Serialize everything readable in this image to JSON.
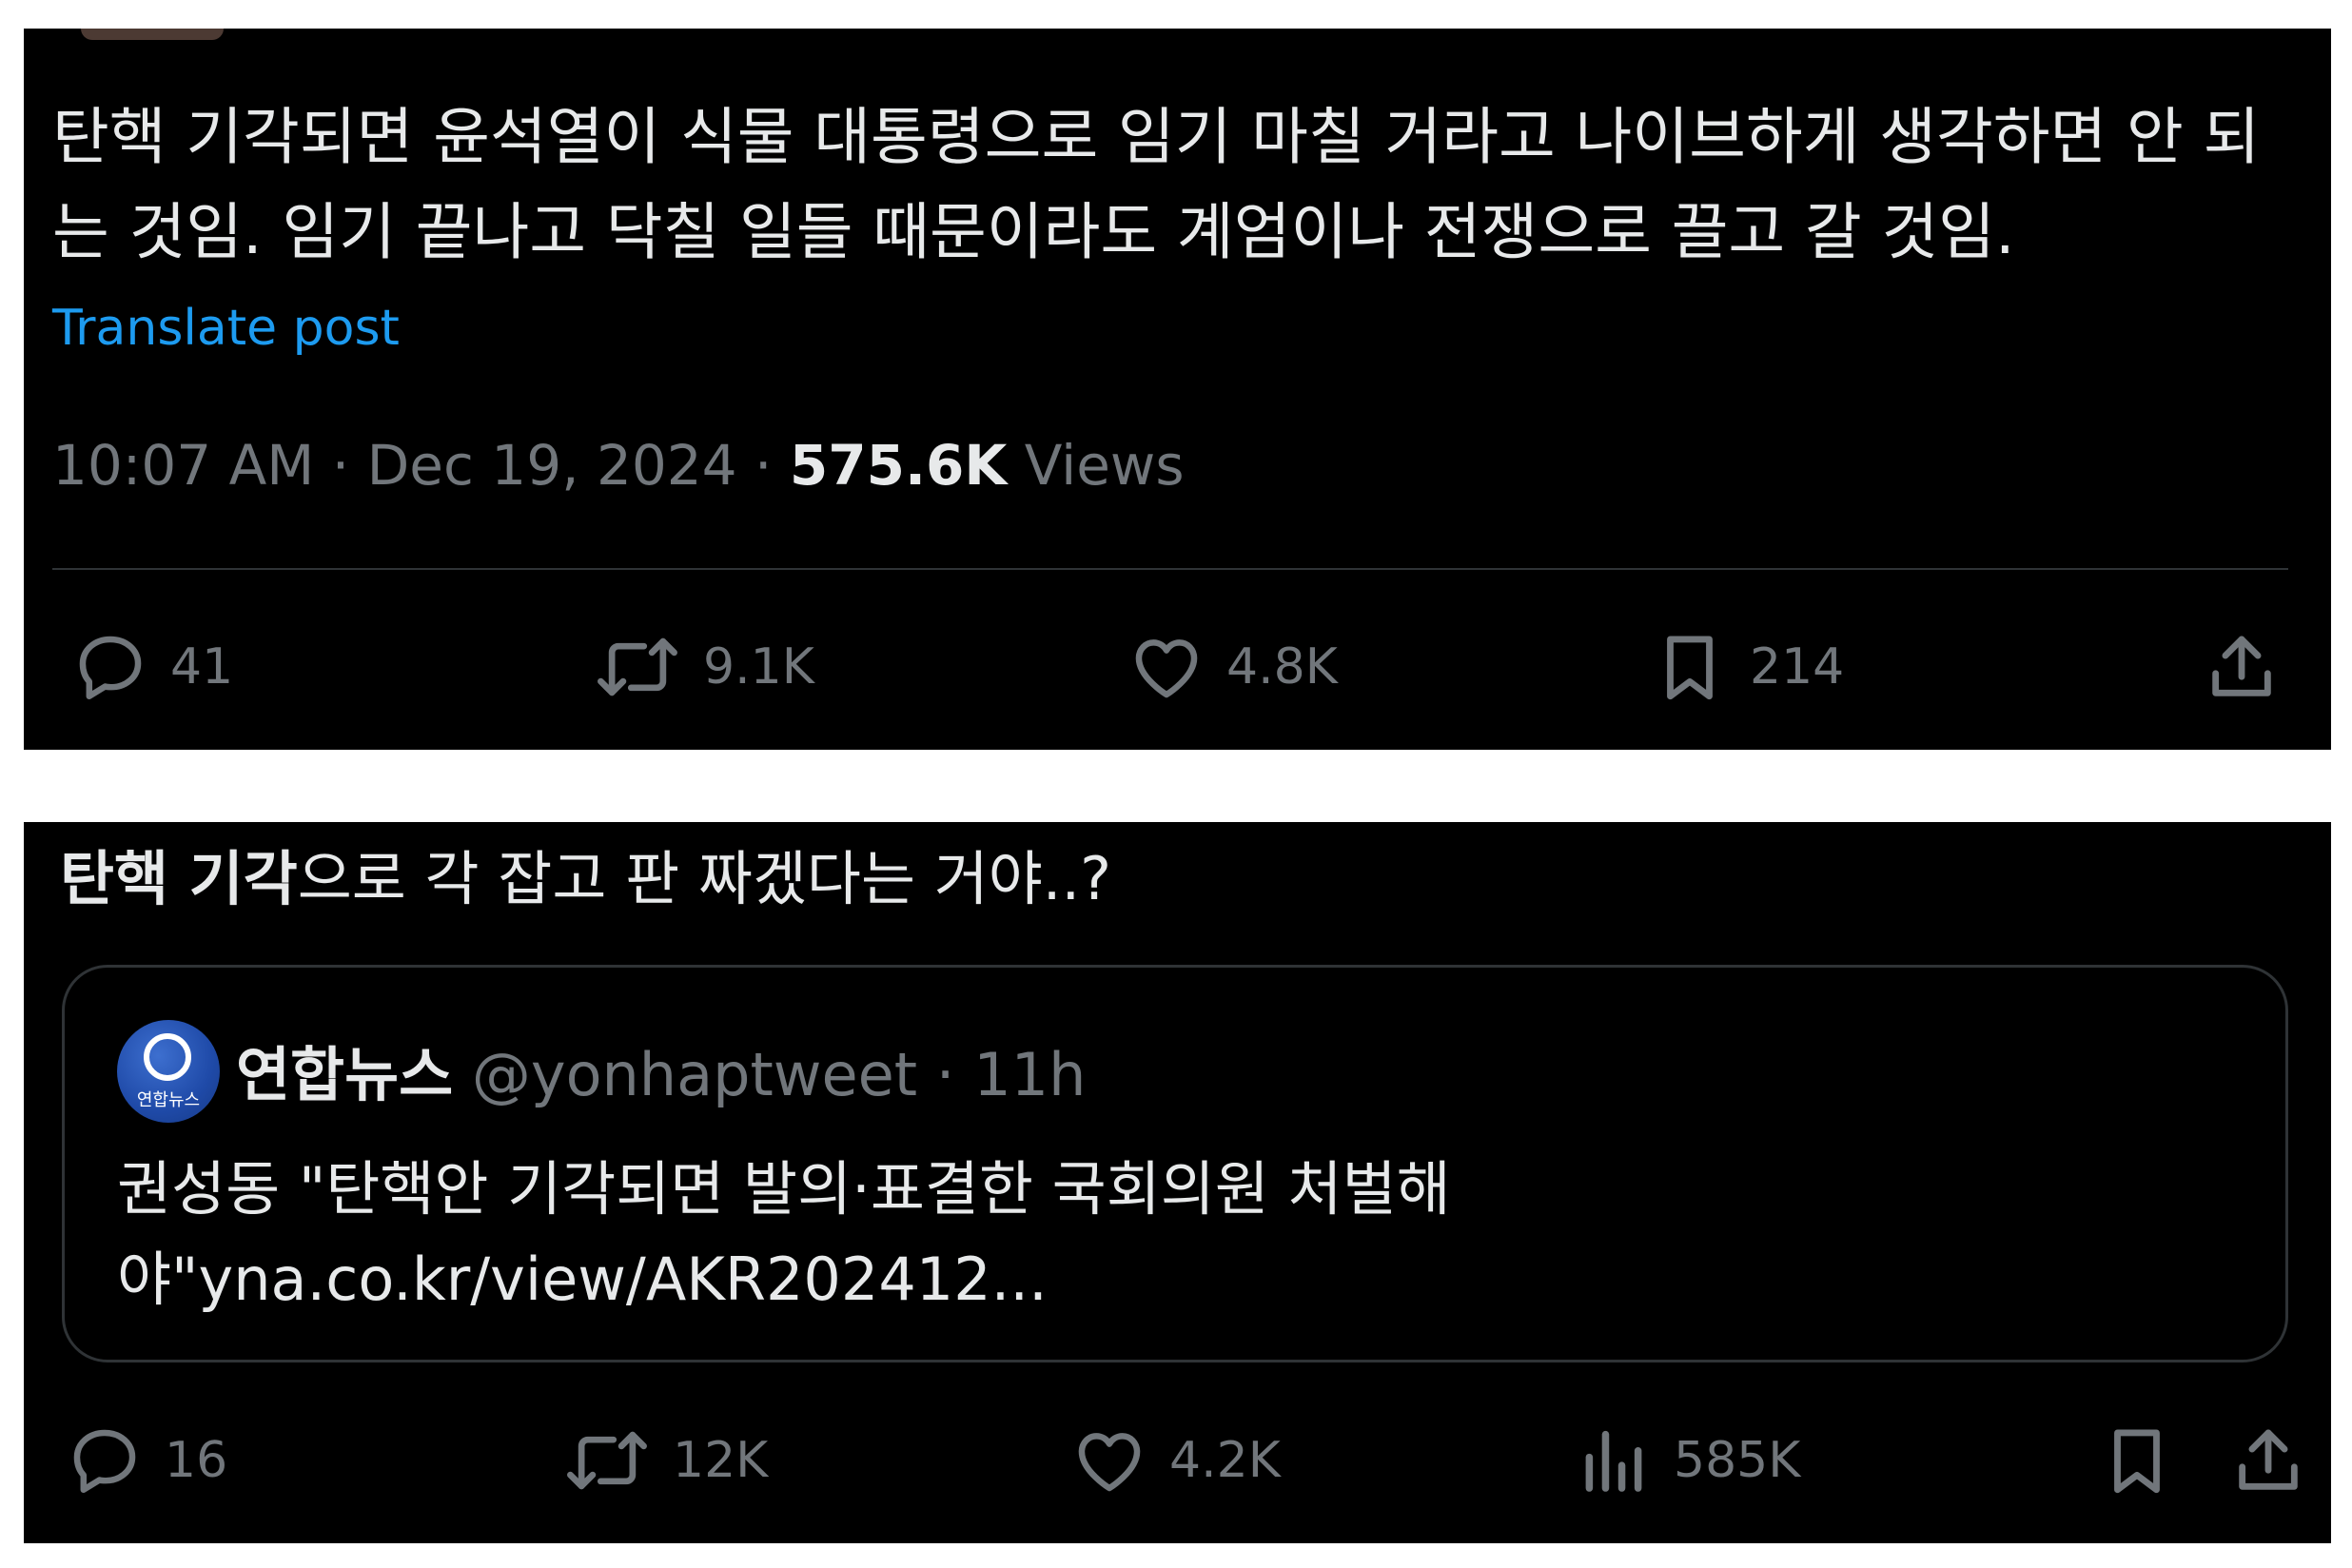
{
  "post": {
    "text": "탄핵 기각되면 윤석열이 식물 대통령으로 임기 마칠 거라고 나이브하게 생각하면 안 되는 것임. 임기 끝나고 닥칠 일들 때문이라도 계엄이나 전쟁으로 끌고 갈 것임.",
    "translate_label": "Translate post",
    "time": "10:07 AM",
    "separator": "·",
    "date": "Dec 19, 2024",
    "views_count": "575.6K",
    "views_label": "Views",
    "actions": {
      "reply_count": "41",
      "repost_count": "9.1K",
      "like_count": "4.8K",
      "bookmark_count": "214"
    }
  },
  "reply": {
    "text_bold": "탄핵 기각",
    "text_rest": "으로 각 잡고 판 짜겠다는 거야..?",
    "quote": {
      "logo_text": "연합뉴스",
      "name": "연합뉴스",
      "handle": "@yonhaptweet",
      "separator": "·",
      "time": "11h",
      "body": "권성동 \"탄핵안 기각되면 발의·표결한 국회의원 처벌해야\"yna.co.kr/view/AKR202412..."
    },
    "actions": {
      "reply_count": "16",
      "repost_count": "12K",
      "like_count": "4.2K",
      "views_count": "585K"
    }
  },
  "colors": {
    "background": "#000000",
    "text": "#e7e9ea",
    "muted": "#71767b",
    "link": "#1d9bf0",
    "border": "#2f3336"
  },
  "icons": [
    "reply-icon",
    "repost-icon",
    "like-icon",
    "bookmark-icon",
    "share-icon",
    "views-icon"
  ]
}
